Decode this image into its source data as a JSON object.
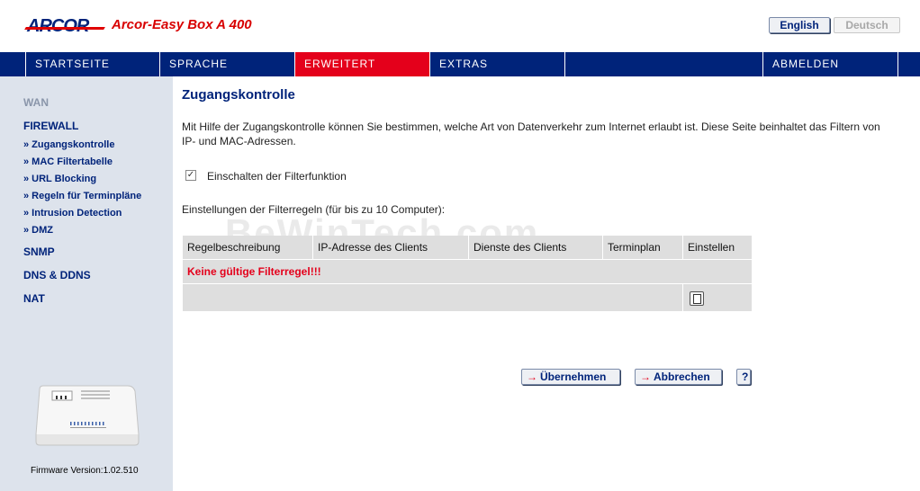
{
  "header": {
    "logo_text": "ARCOR",
    "product_name": "Arcor-Easy Box A 400",
    "lang_english": "English",
    "lang_deutsch": "Deutsch"
  },
  "nav": {
    "startseite": "STARTSEITE",
    "sprache": "SPRACHE",
    "erweitert": "ERWEITERT",
    "extras": "EXTRAS",
    "abmelden": "ABMELDEN"
  },
  "sidebar": {
    "wan": "WAN",
    "firewall": "FIREWALL",
    "sub": [
      "» Zugangskontrolle",
      "» MAC Filtertabelle",
      "» URL Blocking",
      "» Regeln für Terminpläne",
      "» Intrusion Detection",
      "» DMZ"
    ],
    "snmp": "SNMP",
    "dns": "DNS & DDNS",
    "nat": "NAT",
    "firmware": "Firmware Version:1.02.510"
  },
  "main": {
    "title": "Zugangskontrolle",
    "intro": "Mit Hilfe der Zugangskontrolle können Sie bestimmen, welche Art von Datenverkehr zum Internet erlaubt ist. Diese Seite beinhaltet das Filtern von IP- und MAC-Adressen.",
    "checkbox_label": "Einschalten der Filterfunktion",
    "checkbox_checked": true,
    "settings_label": "Einstellungen der Filterregeln (für bis zu 10 Computer):",
    "table": {
      "headers": [
        "Regelbeschreibung",
        "IP-Adresse des Clients",
        "Dienste des Clients",
        "Terminplan",
        "Einstellen"
      ],
      "empty_message": "Keine gültige Filterregel!!!"
    },
    "apply_label": "Übernehmen",
    "cancel_label": "Abbrechen",
    "help_label": "?"
  },
  "watermark": "BeWinTech.com",
  "colors": {
    "brand_blue": "#00237a",
    "accent_red": "#e4001b",
    "sidebar_bg": "#dde3ec"
  }
}
